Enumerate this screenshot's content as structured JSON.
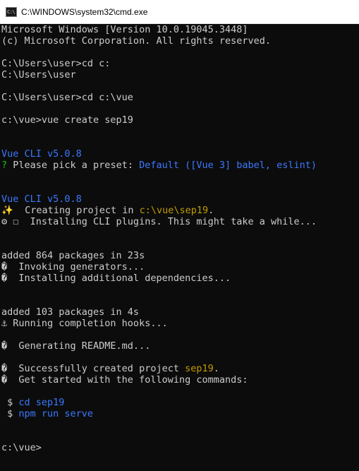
{
  "window": {
    "title": "C:\\WINDOWS\\system32\\cmd.exe",
    "icon": "cmd-icon",
    "icon_text": "C:\\"
  },
  "console": {
    "lines": [
      [
        {
          "t": "Microsoft Windows [Version 10.0.19045.3448]",
          "c": "gray"
        }
      ],
      [
        {
          "t": "(c) Microsoft Corporation. All rights reserved.",
          "c": "gray"
        }
      ],
      [],
      [
        {
          "t": "C:\\Users\\user>cd c:",
          "c": "gray"
        }
      ],
      [
        {
          "t": "C:\\Users\\user",
          "c": "gray"
        }
      ],
      [],
      [
        {
          "t": "C:\\Users\\user>cd c:\\vue",
          "c": "gray"
        }
      ],
      [],
      [
        {
          "t": "c:\\vue>vue create sep19",
          "c": "gray"
        }
      ],
      [],
      [],
      [
        {
          "t": "Vue CLI v5.0.8",
          "c": "blue"
        }
      ],
      [
        {
          "t": "?",
          "c": "green"
        },
        {
          "t": " Please pick a preset: ",
          "c": "gray"
        },
        {
          "t": "Default ([Vue 3] babel, eslint)",
          "c": "blue"
        }
      ],
      [],
      [],
      [
        {
          "t": "Vue CLI v5.0.8",
          "c": "blue"
        }
      ],
      [
        {
          "t": "✨  Creating project in ",
          "c": "gray"
        },
        {
          "t": "c:\\vue\\sep19",
          "c": "yellow"
        },
        {
          "t": ".",
          "c": "gray"
        }
      ],
      [
        {
          "t": "⚙ ☐  Installing CLI plugins. This might take a while...",
          "c": "gray"
        }
      ],
      [],
      [],
      [
        {
          "t": "added 864 packages in 23s",
          "c": "gray"
        }
      ],
      [
        {
          "t": "�  Invoking generators...",
          "c": "gray"
        }
      ],
      [
        {
          "t": "�  Installing additional dependencies...",
          "c": "gray"
        }
      ],
      [],
      [],
      [
        {
          "t": "added 103 packages in 4s",
          "c": "gray"
        }
      ],
      [
        {
          "t": "⚓ Running completion hooks...",
          "c": "gray"
        }
      ],
      [],
      [
        {
          "t": "�  Generating README.md...",
          "c": "gray"
        }
      ],
      [],
      [
        {
          "t": "�  Successfully created project ",
          "c": "gray"
        },
        {
          "t": "sep19",
          "c": "yellow"
        },
        {
          "t": ".",
          "c": "gray"
        }
      ],
      [
        {
          "t": "�  Get started with the following commands:",
          "c": "gray"
        }
      ],
      [],
      [
        {
          "t": " $ ",
          "c": "gray"
        },
        {
          "t": "cd sep19",
          "c": "blue"
        }
      ],
      [
        {
          "t": " $ ",
          "c": "gray"
        },
        {
          "t": "npm run serve",
          "c": "blue"
        }
      ],
      [],
      [],
      [
        {
          "t": "c:\\vue>",
          "c": "gray"
        }
      ]
    ]
  }
}
